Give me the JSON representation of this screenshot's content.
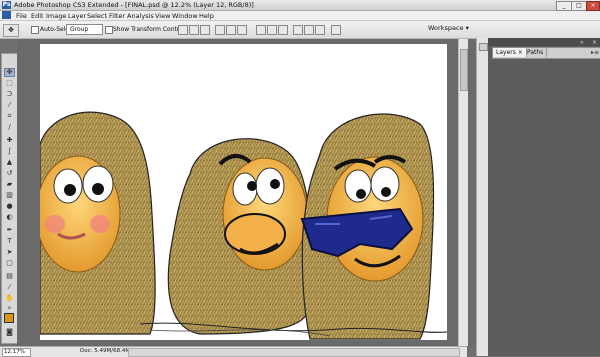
{
  "window": {
    "title": "Adobe Photoshop CS3 Extended - [FINAL.psd @ 12.2% (Layer 12, RGB/8)]",
    "app_icon": "Ps",
    "buttons": [
      "minimize-icon",
      "maximize-icon",
      "close-icon"
    ]
  },
  "menubar": {
    "items": [
      "File",
      "Edit",
      "Image",
      "Layer",
      "Select",
      "Filter",
      "Analysis",
      "View",
      "Window",
      "Help"
    ]
  },
  "options": {
    "auto_select_label": "Auto-Select:",
    "auto_select_value": "Group",
    "show_transform_label": "Show Transform Controls",
    "workspace_label": "Workspace ▾"
  },
  "toolbox": {
    "tools": [
      "move-icon",
      "marquee-icon",
      "lasso-icon",
      "magic-wand-icon",
      "crop-icon",
      "slice-icon",
      "healing-icon",
      "brush-icon",
      "stamp-icon",
      "history-brush-icon",
      "eraser-icon",
      "gradient-icon",
      "blur-icon",
      "dodge-icon",
      "pen-icon",
      "type-icon",
      "path-select-icon",
      "shape-icon",
      "notes-icon",
      "eyedropper-icon",
      "hand-icon",
      "zoom-icon"
    ],
    "foreground_color": "#d7951a",
    "background_color": "#ffffff"
  },
  "status": {
    "zoom": "12.17%",
    "doc": "Doc: 5.49M/68.4M"
  },
  "panels": {
    "tabs": [
      "Layers ×",
      "Paths"
    ],
    "active_tab": 0
  },
  "colors": {
    "fur": "#b59a55",
    "face": "#f2b24a",
    "glasses": "#1e2a8c"
  }
}
